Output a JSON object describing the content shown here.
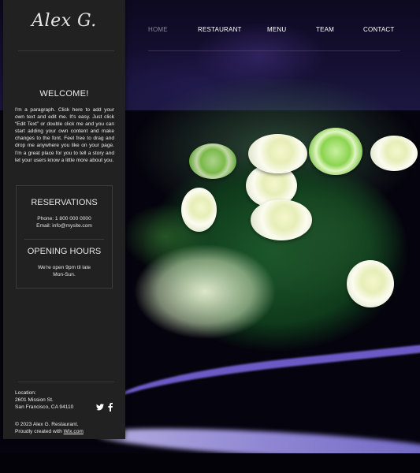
{
  "brand": {
    "logo_text": "Alex G."
  },
  "nav": {
    "items": [
      {
        "label": "HOME",
        "active": true
      },
      {
        "label": "RESTAURANT",
        "active": false
      },
      {
        "label": "MENU",
        "active": false
      },
      {
        "label": "TEAM",
        "active": false
      },
      {
        "label": "CONTACT",
        "active": false
      }
    ]
  },
  "sidebar": {
    "welcome": {
      "title": "WELCOME!",
      "text": "I'm a paragraph. Click here to add your own text and edit me. It's easy. Just click “Edit Text” or double click me and you can start adding your own content and make changes to the font. Feel free to drag and drop me anywhere you like on your page. I'm a great place for you to tell a story and let your users know a little more about you."
    },
    "reservations": {
      "title": "RESERVATIONS",
      "phone": "Phone:  1 800 000 0000",
      "email": "Email:  info@mysite.com"
    },
    "opening_hours": {
      "title": "OPENING HOURS",
      "line1": "We're open 9pm til late",
      "line2": "Mon-Sun."
    },
    "location": {
      "label": "Location:",
      "street": "2601 Mission St.",
      "city": "San Francisco, CA 94110"
    },
    "social": {
      "twitter_icon": "twitter-icon",
      "facebook_icon": "facebook-icon"
    },
    "footer": {
      "copyright": "© 2023 Alex G. Restaurant.",
      "created_prefix": "Proudly created with ",
      "created_link": "Wix.com"
    }
  },
  "colors": {
    "sidebar_bg": "#212121",
    "nav_active": "#8a8698",
    "nav_text": "#ffffff"
  }
}
